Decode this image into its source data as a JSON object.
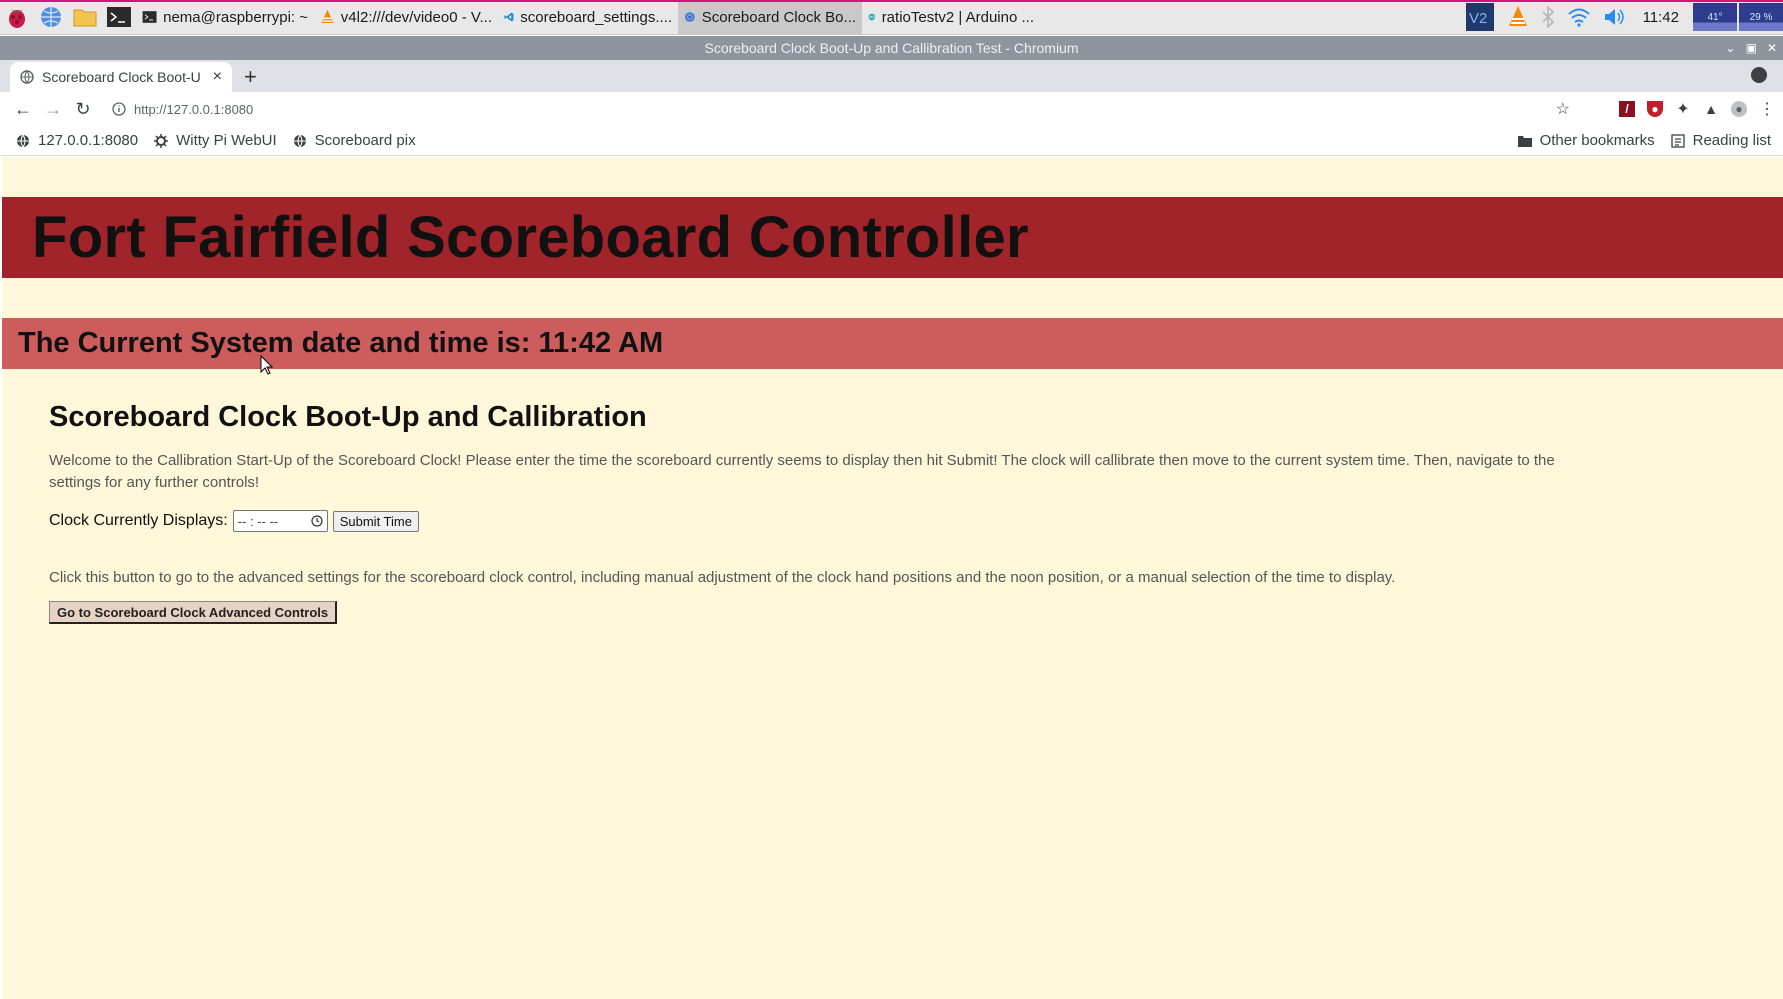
{
  "taskbar": {
    "tasks": [
      {
        "label": "nema@raspberrypi: ~",
        "icon": "terminal-icon"
      },
      {
        "label": "v4l2:///dev/video0 - V...",
        "icon": "vlc-icon"
      },
      {
        "label": "scoreboard_settings....",
        "icon": "vscode-icon"
      },
      {
        "label": "Scoreboard Clock Bo...",
        "icon": "chromium-icon",
        "active": true
      },
      {
        "label": "ratioTestv2 | Arduino ...",
        "icon": "arduino-icon"
      }
    ],
    "clock": "11:42",
    "cpu_temp": "41°",
    "cpu_usage": "29 %"
  },
  "window": {
    "title": "Scoreboard Clock Boot-Up and Callibration Test - Chromium"
  },
  "browser": {
    "tab_title": "Scoreboard Clock Boot-U",
    "url": "http://127.0.0.1:8080",
    "bookmarks": [
      "127.0.0.1:8080",
      "Witty Pi WebUI",
      "Scoreboard pix"
    ],
    "other_bookmarks": "Other bookmarks",
    "reading_list": "Reading list"
  },
  "page": {
    "header": "Fort Fairfield Scoreboard Controller",
    "current_time_text": "The Current System date and time is: 11:42 AM",
    "section_title": "Scoreboard Clock Boot-Up and Callibration",
    "intro_text": "Welcome to the Callibration Start-Up of the Scoreboard Clock! Please enter the time the scoreboard currently seems to display then hit Submit! The clock will callibrate then move to the current system time. Then, navigate to the settings for any further controls!",
    "clock_label": "Clock Currently Displays:",
    "time_placeholder": "-- : -- --",
    "submit_label": "Submit Time",
    "advanced_text": "Click this button to go to the advanced settings for the scoreboard clock control, including manual adjustment of the clock hand positions and the noon position, or a manual selection of the time to display.",
    "advanced_button": "Go to Scoreboard Clock Advanced Controls"
  },
  "colors": {
    "page_bg": "#fff7d9",
    "header_band": "#a1242a",
    "time_band": "#cd5c5c"
  }
}
